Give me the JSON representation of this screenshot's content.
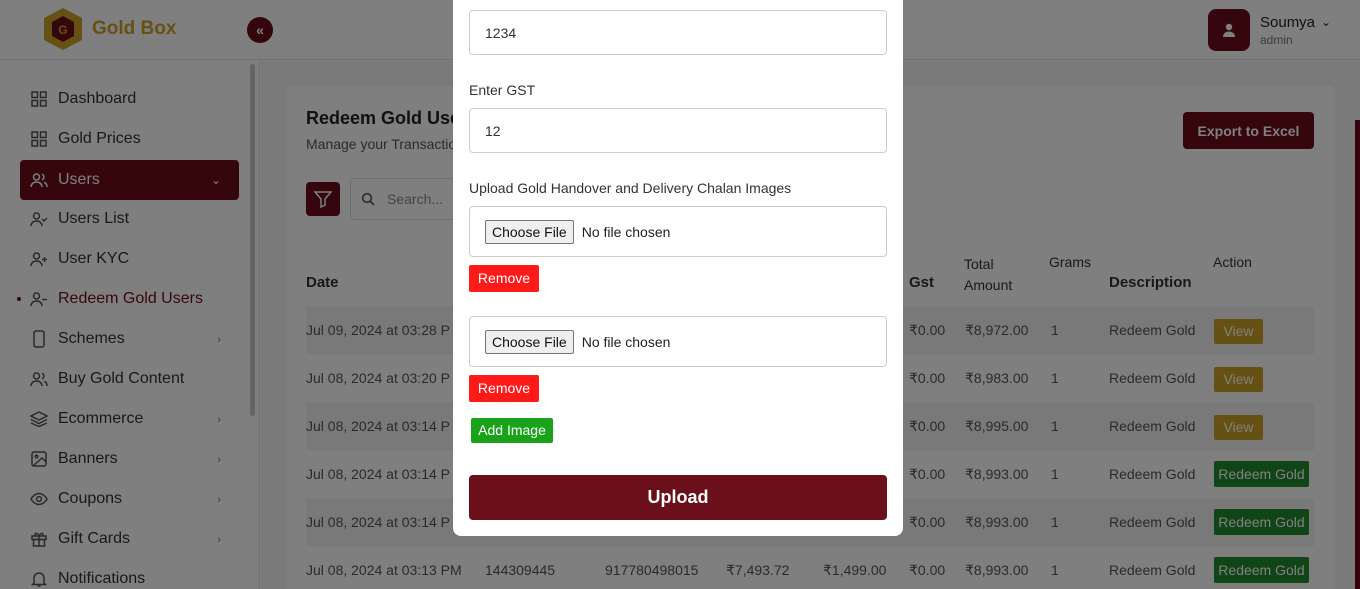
{
  "brand": {
    "name": "Gold Box",
    "collapse_icon": "double-chevron-left-icon"
  },
  "user": {
    "name": "Soumya",
    "role": "admin"
  },
  "sidebar": {
    "items": [
      {
        "label": "Dashboard",
        "icon": "grid-icon"
      },
      {
        "label": "Gold Prices",
        "icon": "grid-icon"
      },
      {
        "label": "Users",
        "icon": "users-icon",
        "active": true
      },
      {
        "label": "Users List",
        "icon": "user-check-icon"
      },
      {
        "label": "User KYC",
        "icon": "user-plus-icon"
      },
      {
        "label": "Redeem Gold Users",
        "icon": "user-minus-icon",
        "current": true
      },
      {
        "label": "Schemes",
        "icon": "phone-icon"
      },
      {
        "label": "Buy Gold Content",
        "icon": "users-icon"
      },
      {
        "label": "Ecommerce",
        "icon": "layers-icon"
      },
      {
        "label": "Banners",
        "icon": "image-icon"
      },
      {
        "label": "Coupons",
        "icon": "eye-icon"
      },
      {
        "label": "Gift Cards",
        "icon": "gift-icon"
      },
      {
        "label": "Notifications",
        "icon": "bell-icon"
      }
    ]
  },
  "page": {
    "title": "Redeem Gold Use",
    "subtitle": "Manage your Transactio",
    "export_label": "Export to Excel",
    "search_placeholder": "Search..."
  },
  "table": {
    "headers": {
      "date": "Date",
      "gst": "Gst",
      "total_amount": "Total Amount",
      "grams": "Grams",
      "description": "Description",
      "action": "Action"
    },
    "rows": [
      {
        "date": "Jul 09, 2024 at 03:28 P",
        "gst": "₹0.00",
        "total": "₹8,972.00",
        "grams": "1",
        "description": "Redeem Gold",
        "action": "View"
      },
      {
        "date": "Jul 08, 2024 at 03:20 P",
        "gst": "₹0.00",
        "total": "₹8,983.00",
        "grams": "1",
        "description": "Redeem Gold",
        "action": "View"
      },
      {
        "date": "Jul 08, 2024 at 03:14 P",
        "gst": "₹0.00",
        "total": "₹8,995.00",
        "grams": "1",
        "description": "Redeem Gold",
        "action": "View"
      },
      {
        "date": "Jul 08, 2024 at 03:14 P",
        "gst": "₹0.00",
        "total": "₹8,993.00",
        "grams": "1",
        "description": "Redeem Gold",
        "action": "Redeem Gold"
      },
      {
        "date": "Jul 08, 2024 at 03:14 P",
        "gst": "₹0.00",
        "total": "₹8,993.00",
        "grams": "1",
        "description": "Redeem Gold",
        "action": "Redeem Gold"
      },
      {
        "date": "Jul 08, 2024 at 03:13 PM",
        "txn": "144309445",
        "phone": "917780498015",
        "amount": "₹7,493.72",
        "tax": "₹1,499.00",
        "gst": "₹0.00",
        "total": "₹8,993.00",
        "grams": "1",
        "description": "Redeem Gold",
        "action": "Redeem Gold"
      }
    ]
  },
  "modal": {
    "first_value": "1234",
    "gst_label": "Enter GST",
    "gst_value": "12",
    "upload_label": "Upload Gold Handover and Delivery Chalan Images",
    "choose_file": "Choose File",
    "no_file": "No file chosen",
    "remove_label": "Remove",
    "add_image_label": "Add Image",
    "upload_button": "Upload"
  },
  "colors": {
    "brand": "#6b0f1a",
    "gold": "#c9a227",
    "green": "#1f8a2e",
    "danger": "#ff1a1a"
  }
}
